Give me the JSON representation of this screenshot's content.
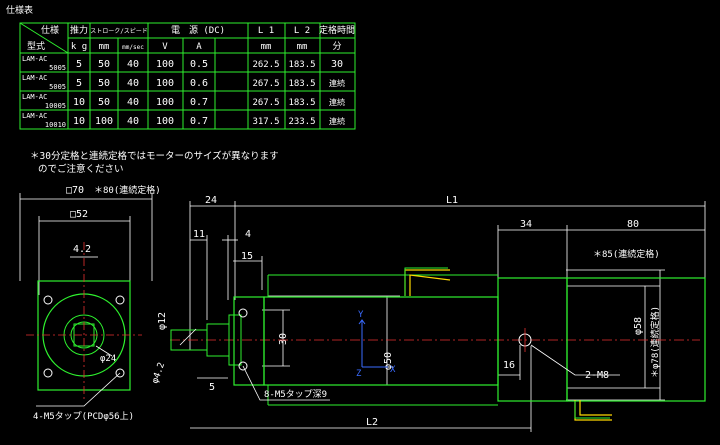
{
  "spec_table": {
    "caption": "仕様表",
    "header_top": {
      "spec": "仕様",
      "thrust": "推力",
      "stroke_speed": "ストローク/スピード",
      "power": "電　源 (DC)",
      "l1": "L 1",
      "l2": "L 2",
      "rated_time": "定格時間"
    },
    "header_bottom": {
      "model": "型式",
      "kg": "k g",
      "mm": "mm",
      "mm_sec": "mm/sec",
      "v": "V",
      "a": "A",
      "l1_unit": "mm",
      "l2_unit": "mm",
      "minutes": "分"
    },
    "rows": [
      {
        "model1": "LAM-AC",
        "model2": "5005",
        "thrust": "5",
        "stroke": "50",
        "speed": "40",
        "v": "100",
        "a": "0.5",
        "l1": "262.5",
        "l2": "183.5",
        "time": "30"
      },
      {
        "model1": "LAM-AC",
        "model2": "5005",
        "thrust": "5",
        "stroke": "50",
        "speed": "40",
        "v": "100",
        "a": "0.6",
        "l1": "267.5",
        "l2": "183.5",
        "time": "連続"
      },
      {
        "model1": "LAM-AC",
        "model2": "10005",
        "thrust": "10",
        "stroke": "50",
        "speed": "40",
        "v": "100",
        "a": "0.7",
        "l1": "267.5",
        "l2": "183.5",
        "time": "連続"
      },
      {
        "model1": "LAM-AC",
        "model2": "10010",
        "thrust": "10",
        "stroke": "100",
        "speed": "40",
        "v": "100",
        "a": "0.7",
        "l1": "317.5",
        "l2": "233.5",
        "time": "連続"
      }
    ]
  },
  "note": {
    "line1": "＊30分定格と連続定格ではモーターのサイズが異なります",
    "line2": "のでご注意ください"
  },
  "front_view": {
    "outer_size": "□70",
    "motor_size": "＊80(連続定格)",
    "inner_size": "□52",
    "offset": "4.2",
    "shaft_dia": "φ24",
    "tap": "4-M5タップ(PCDφ56上)"
  },
  "side_view": {
    "dim_24": "24",
    "dim_11": "11",
    "dim_4": "4",
    "dim_15": "15",
    "dim_12": "φ12",
    "dim_42": "φ4.2",
    "dim_5": "5",
    "dim_30": "30",
    "dim_50": "φ50",
    "tap_label": "8-M5タップ深9",
    "l1": "L1",
    "l2": "L2",
    "dim_34": "34",
    "dim_80": "80",
    "motor85": "＊85(連続定格)",
    "dim_58": "φ58",
    "dim_78": "＊φ78(連続定格)",
    "dim_16": "16",
    "tap_m8": "2-M8",
    "axis_y": "Y",
    "axis_z": "Z",
    "axis_x": "X"
  },
  "colors": {
    "background": "#000000",
    "outline": "#2ef02e",
    "text": "#ffffff",
    "center_line": "#e83030",
    "axis": "#3a6bff",
    "wire": "#ffd800"
  }
}
